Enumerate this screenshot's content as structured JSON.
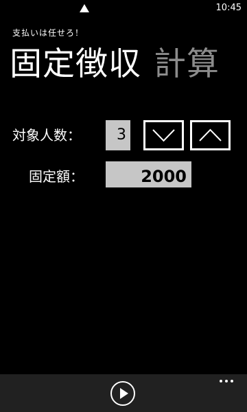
{
  "status_bar": {
    "time": "10:45",
    "signal_icon": "signal-triangle-icon"
  },
  "app": {
    "title": "支払いは任せろ！"
  },
  "pivot": {
    "active": "固定徴収",
    "inactive": "計算"
  },
  "form": {
    "people_label": "対象人数：",
    "people_value": "3",
    "decrement_icon": "chevron-down-icon",
    "increment_icon": "chevron-up-icon",
    "amount_label": "固定額：",
    "amount_value": "2000"
  },
  "app_bar": {
    "play_icon": "play-icon",
    "more_icon": "ellipsis-icon"
  },
  "colors": {
    "background": "#000000",
    "text": "#ffffff",
    "inactive_pivot": "#8c8c8c",
    "field_bg": "#c6c6c6",
    "app_bar_bg": "#212121"
  }
}
